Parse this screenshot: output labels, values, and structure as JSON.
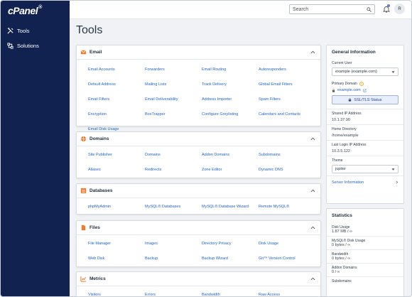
{
  "brand": {
    "logo": "cPanel",
    "reg": "®"
  },
  "sidebar": {
    "items": [
      {
        "label": "Tools",
        "icon": "tools-icon"
      },
      {
        "label": "Solutions",
        "icon": "solutions-icon"
      }
    ]
  },
  "topbar": {
    "search_placeholder": "Search",
    "avatar_initial": "R"
  },
  "page_title": "Tools",
  "sections": [
    {
      "title": "Email",
      "icon": "email-icon",
      "links": [
        "Email Accounts",
        "Forwarders",
        "Email Routing",
        "Autoresponders",
        "Default Address",
        "Mailing Lists",
        "Track Delivery",
        "Global Email Filters",
        "Email Filters",
        "Email Deliverability",
        "Address Importer",
        "Spam Filters",
        "Encryption",
        "BoxTrapper",
        "Configure Greylisting",
        "Calendars and Contacts",
        "Email Disk Usage"
      ]
    },
    {
      "title": "Domains",
      "icon": "domains-icon",
      "links": [
        "Site Publisher",
        "Domains",
        "Addon Domains",
        "Subdomains",
        "Aliases",
        "Redirects",
        "Zone Editor",
        "Dynamic DNS"
      ]
    },
    {
      "title": "Databases",
      "icon": "databases-icon",
      "links": [
        "phpMyAdmin",
        "MySQL® Databases",
        "MySQL® Database Wizard",
        "Remote MySQL®"
      ]
    },
    {
      "title": "Files",
      "icon": "files-icon",
      "links": [
        "File Manager",
        "Images",
        "Directory Privacy",
        "Disk Usage",
        "Web Disk",
        "Backup",
        "Backup Wizard",
        "Git™ Version Control"
      ]
    },
    {
      "title": "Metrics",
      "icon": "metrics-icon",
      "links": [
        "Visitors",
        "Errors",
        "Bandwidth",
        "Raw Access"
      ]
    }
  ],
  "general_info": {
    "title": "General Information",
    "current_user_label": "Current User",
    "current_user_value": "example (example.com)",
    "primary_domain_label": "Primary Domain",
    "primary_domain_value": "example.com",
    "ssl_button": "SSL/TLS Status",
    "shared_ip_label": "Shared IP Address",
    "shared_ip_value": "10.1.37.90",
    "home_dir_label": "Home Directory",
    "home_dir_value": "/home/example",
    "last_login_label": "Last Login IP Address",
    "last_login_value": "10.3.5.122",
    "theme_label": "Theme",
    "theme_value": "jupiter",
    "server_info_link": "Server Information"
  },
  "statistics": {
    "title": "Statistics",
    "items": [
      {
        "label": "Disk Usage",
        "value": "1.87 MB / ∞"
      },
      {
        "label": "MySQL® Disk Usage",
        "value": "0 bytes / ∞"
      },
      {
        "label": "Bandwidth",
        "value": "0 bytes / ∞"
      },
      {
        "label": "Addon Domains",
        "value": "0 / ∞"
      },
      {
        "label": "Subdomains",
        "value": ""
      }
    ]
  }
}
